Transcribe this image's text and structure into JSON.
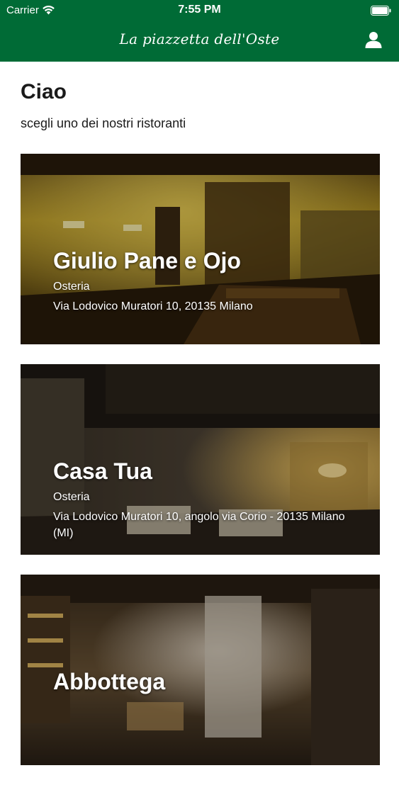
{
  "status_bar": {
    "carrier": "Carrier",
    "time": "7:55 PM",
    "wifi_icon": "wifi-icon",
    "battery_icon": "battery-icon"
  },
  "nav": {
    "title": "La piazzetta dell'Oste",
    "profile_icon": "user-icon"
  },
  "colors": {
    "header_bg": "#006b36",
    "background": "#ffffff",
    "text": "#1a1a1a",
    "card_text": "#ffffff"
  },
  "greeting": {
    "title": "Ciao",
    "subtitle": "scegli uno dei nostri ristoranti"
  },
  "restaurants": [
    {
      "name": "Giulio Pane e Ojo",
      "type": "Osteria",
      "address": "Via Lodovico Muratori 10, 20135 Milano"
    },
    {
      "name": "Casa Tua",
      "type": "Osteria",
      "address": "Via Lodovico Muratori 10, angolo via Corio - 20135 Milano (MI)"
    },
    {
      "name": "Abbottega",
      "type": "",
      "address": ""
    }
  ]
}
